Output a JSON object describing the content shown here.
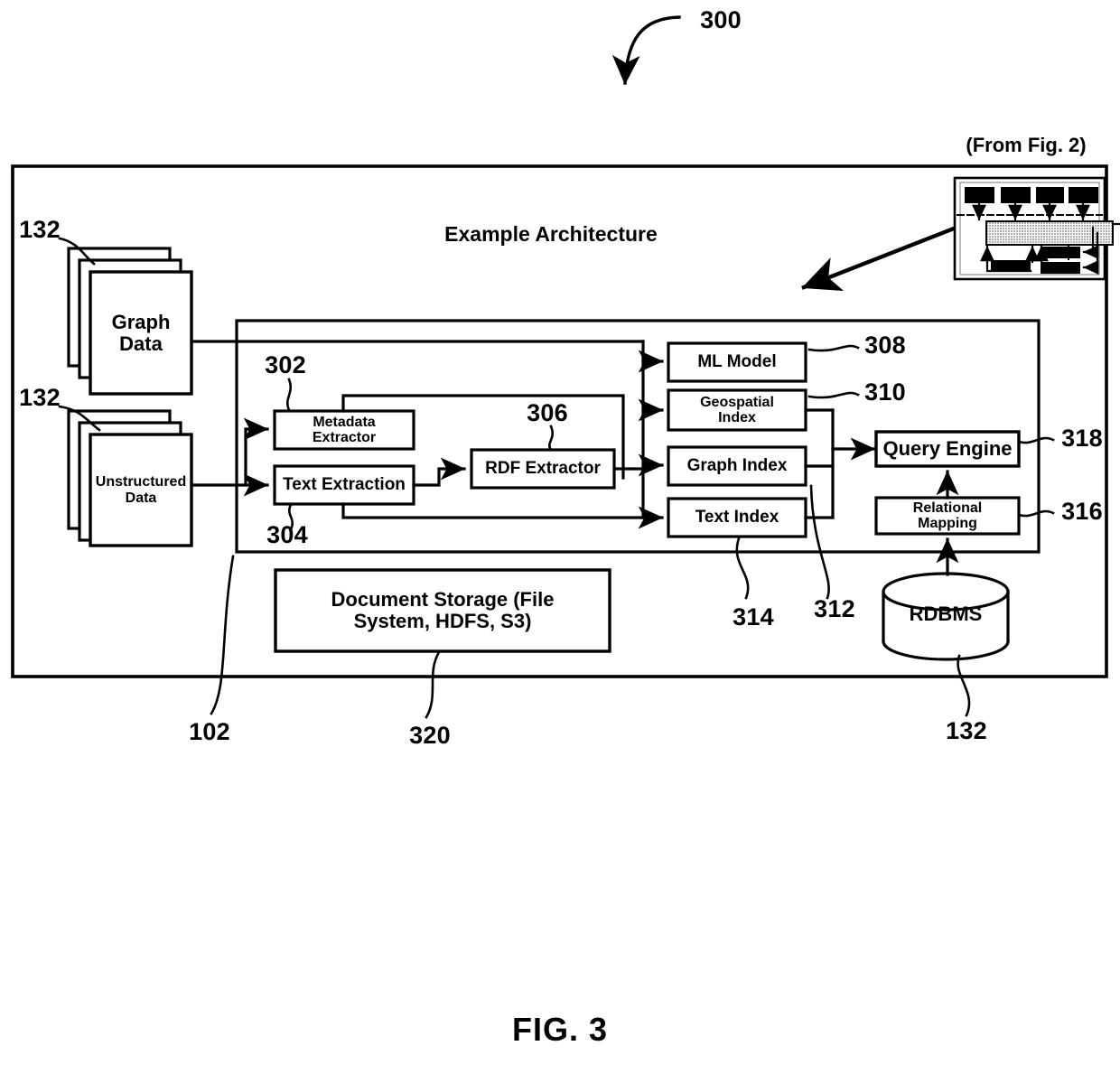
{
  "figure": {
    "number_callout": "300",
    "caption": "FIG. 3",
    "from_note": "(From Fig. 2)",
    "title": "Example Architecture"
  },
  "outer_system": {
    "ref": "102"
  },
  "data_sources": [
    {
      "label": "Graph\nData",
      "ref": "132"
    },
    {
      "label": "Unstructured\nData",
      "ref": "132"
    }
  ],
  "extractors": [
    {
      "label": "Metadata\nExtractor",
      "ref": "302"
    },
    {
      "label": "Text Extraction",
      "ref": "304"
    },
    {
      "label": "RDF Extractor",
      "ref": "306"
    }
  ],
  "indexes": [
    {
      "label": "ML Model",
      "ref": "308"
    },
    {
      "label": "Geospatial\nIndex",
      "ref": "310"
    },
    {
      "label": "Graph Index",
      "ref": "312"
    },
    {
      "label": "Text Index",
      "ref": "314"
    }
  ],
  "query_side": [
    {
      "label": "Query Engine",
      "ref": "318"
    },
    {
      "label": "Relational\nMapping",
      "ref": "316"
    }
  ],
  "database": {
    "label": "RDBMS",
    "ref": "132"
  },
  "storage": {
    "label": "Document Storage (File\nSystem, HDFS, S3)",
    "ref": "320"
  },
  "thumbnail": {
    "name": "fig-2-thumbnail"
  },
  "colors": {
    "stroke": "#000000",
    "background": "#ffffff",
    "hatch": "#b8b8b8"
  }
}
